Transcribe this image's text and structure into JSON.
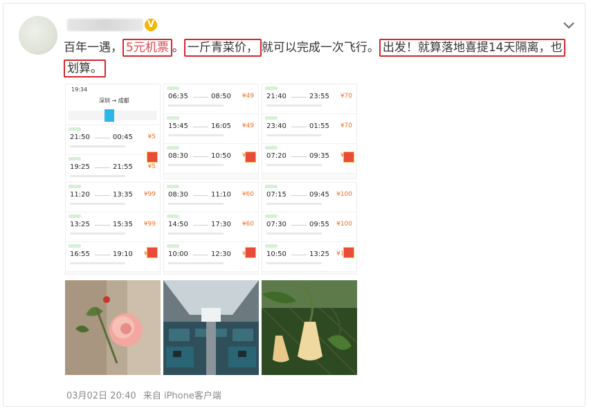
{
  "post": {
    "segments": [
      {
        "text": "百年一遇，",
        "boxed": false,
        "red": false
      },
      {
        "text": "5元机票",
        "boxed": true,
        "red": true
      },
      {
        "text": "。",
        "boxed": false,
        "red": false
      },
      {
        "text": "一斤青菜价，",
        "boxed": true,
        "red": false
      },
      {
        "text": "就可以完成一次飞行。",
        "boxed": false,
        "red": false
      },
      {
        "text": "出发！就算落地喜提14天隔离，也",
        "boxed": true,
        "red": false
      },
      {
        "text": "划算。",
        "boxed": true,
        "red": false
      }
    ]
  },
  "verified_badge": "V",
  "screenshots": {
    "app_header": {
      "time": "19:34",
      "route": "深圳 → 成都"
    },
    "col1": [
      {
        "dep": "21:50",
        "arr": "00:45",
        "price": "¥5"
      },
      {
        "dep": "19:25",
        "arr": "21:55",
        "price": "¥5"
      },
      {
        "dep": "11:20",
        "arr": "13:35",
        "price": "¥99"
      },
      {
        "dep": "13:25",
        "arr": "15:35",
        "price": "¥99"
      },
      {
        "dep": "16:55",
        "arr": "19:10",
        "price": "¥99"
      }
    ],
    "col2": [
      {
        "dep": "06:35",
        "arr": "08:50",
        "price": "¥49"
      },
      {
        "dep": "15:45",
        "arr": "16:05",
        "price": "¥49"
      },
      {
        "dep": "08:30",
        "arr": "10:50",
        "price": "¥49"
      },
      {
        "dep": "08:30",
        "arr": "11:10",
        "price": "¥60"
      },
      {
        "dep": "14:50",
        "arr": "17:30",
        "price": "¥60"
      },
      {
        "dep": "10:00",
        "arr": "12:30",
        "price": "¥60"
      }
    ],
    "col3": [
      {
        "dep": "21:40",
        "arr": "23:55",
        "price": "¥70"
      },
      {
        "dep": "23:40",
        "arr": "01:55",
        "price": "¥70"
      },
      {
        "dep": "07:20",
        "arr": "09:35",
        "price": "¥80"
      },
      {
        "dep": "07:15",
        "arr": "09:45",
        "price": "¥100"
      },
      {
        "dep": "07:30",
        "arr": "09:55",
        "price": "¥100"
      },
      {
        "dep": "10:50",
        "arr": "13:25",
        "price": "¥100"
      }
    ]
  },
  "photos": [
    "rose-photo",
    "airplane-cabin-photo",
    "trumpet-flower-photo"
  ],
  "footer": {
    "timestamp": "03月02日 20:40",
    "source": "来自 iPhone客户端"
  },
  "colors": {
    "highlight_box": "#d4262c",
    "price": "#f26b21",
    "red_text": "#e0454a"
  }
}
